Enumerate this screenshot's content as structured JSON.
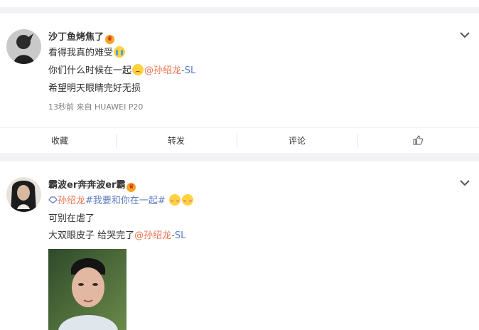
{
  "posts": [
    {
      "username": "沙丁鱼烤焦了",
      "lines": [
        "看得我真的难受",
        "你们什么时候在一起",
        "希望明天眼睛完好无损"
      ],
      "mention_name": "@孙绍龙",
      "mention_suffix": "-SL",
      "meta": "13秒前 来自 HUAWEI P20",
      "actions": [
        "收藏",
        "转发",
        "评论"
      ],
      "icons": [
        "crown-icon",
        "crying-emoji",
        "sad-emoji",
        "chevron-down-icon",
        "like-icon"
      ]
    },
    {
      "username": "霸波er奔奔波er霸",
      "topic_prefix": "孙绍龙",
      "topic": "#我要和你在一起#",
      "lines": [
        "可别在虐了",
        "大双眼皮子 给哭完了"
      ],
      "mention_name": "@孙绍龙",
      "mention_suffix": "-SL",
      "icons": [
        "crown-icon",
        "link-icon",
        "shy-emoji",
        "chevron-down-icon"
      ]
    }
  ],
  "colors": {
    "mention": "#eb7350",
    "link": "#5b7cc1",
    "background": "#f2f2f5"
  }
}
